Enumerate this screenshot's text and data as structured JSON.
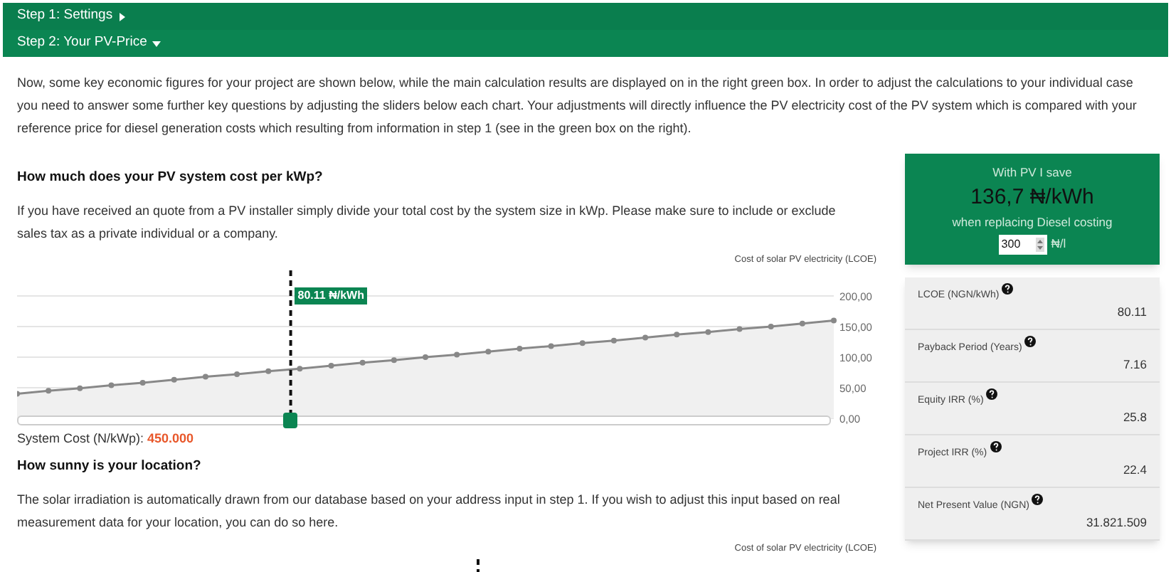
{
  "steps": [
    {
      "label": "Step 1: Settings",
      "expanded": false
    },
    {
      "label": "Step 2: Your PV-Price",
      "expanded": true
    }
  ],
  "intro": "Now, some key economic figures for your project are shown below, while the main calculation results are displayed on in the right green box. In order to adjust the calculations to your individual case you need to answer some further key questions by adjusting the sliders below each chart. Your adjustments will directly influence the PV electricity cost of the PV system which is compared with your reference price for diesel generation costs which resulting from information in step 1 (see in the green box on the right).",
  "sections": [
    {
      "heading": "How much does your PV system cost per kWp?",
      "text": "If you have received an quote from a PV installer simply divide your total cost by the system size in kWp. Please make sure to include or exclude sales tax as a private individual or a company.",
      "marker_label": "80.11 ₦/kWh",
      "chart_data": {
        "type": "area",
        "title": "Cost of solar PV electricity (LCOE)",
        "grid": true,
        "ylim": [
          0,
          200
        ],
        "yticks": [
          {
            "value": 0,
            "label": "0,00"
          },
          {
            "value": 50,
            "label": "50,00"
          },
          {
            "value": 100,
            "label": "100,00"
          },
          {
            "value": 150,
            "label": "150,00"
          },
          {
            "value": 200,
            "label": "200,00"
          }
        ],
        "values": [
          40,
          45,
          49,
          54,
          58,
          63,
          68,
          72,
          77,
          81,
          86,
          91,
          95,
          100,
          104,
          109,
          114,
          118,
          123,
          127,
          132,
          137,
          141,
          146,
          150,
          155,
          160
        ]
      },
      "slider": {
        "level": 0.335,
        "label": "System Cost (N/kWp):",
        "value": "450.000"
      }
    },
    {
      "heading": "How sunny is your location?",
      "text": "The solar irradiation is automatically drawn from our database based on your address input in step 1. If you wish to adjust this input based on real measurement data for your location, you can do so here.",
      "chart_title": "Cost of solar PV electricity (LCOE)"
    }
  ],
  "savings": {
    "title": "With PV I save",
    "amount": "136,7 ₦/kWh",
    "subtitle": "when replacing Diesel costing",
    "diesel_price": "300",
    "unit": "₦/l"
  },
  "metrics": [
    {
      "label": "LCOE (NGN/kWh)",
      "value": "80.11"
    },
    {
      "label": "Payback Period (Years)",
      "value": "7.16"
    },
    {
      "label": "Equity IRR (%)",
      "value": "25.8"
    },
    {
      "label": "Project IRR (%)",
      "value": "22.4"
    },
    {
      "label": "Net Present Value (NGN)",
      "value": "31.821.509"
    }
  ]
}
